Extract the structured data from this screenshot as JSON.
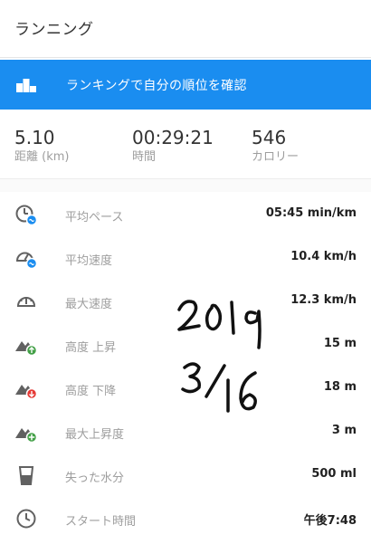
{
  "header": {
    "title": "ランニング"
  },
  "banner": {
    "label": "ランキングで自分の順位を確認"
  },
  "summary": [
    {
      "value": "5.10",
      "label": "距離 (km)"
    },
    {
      "value": "00:29:21",
      "label": "時間"
    },
    {
      "value": "546",
      "label": "カロリー"
    }
  ],
  "stats": [
    {
      "icon": "average-pace-icon",
      "label": "平均ペース",
      "value": "05:45 min/km"
    },
    {
      "icon": "average-speed-icon",
      "label": "平均速度",
      "value": "10.4 km/h"
    },
    {
      "icon": "max-speed-icon",
      "label": "最大速度",
      "value": "12.3 km/h"
    },
    {
      "icon": "elevation-gain-icon",
      "label": "高度 上昇",
      "value": "15 m"
    },
    {
      "icon": "elevation-loss-icon",
      "label": "高度 下降",
      "value": "18 m"
    },
    {
      "icon": "max-elevation-icon",
      "label": "最大上昇度",
      "value": "3 m"
    },
    {
      "icon": "water-glass-icon",
      "label": "失った水分",
      "value": "500 ml"
    },
    {
      "icon": "clock-icon",
      "label": "スタート時間",
      "value": "午後7:48"
    }
  ],
  "handwritten_note": {
    "line1": "2019",
    "line2": "3/16"
  },
  "colors": {
    "accent": "#1a8df0",
    "up": "#43a047",
    "down": "#e53935"
  }
}
